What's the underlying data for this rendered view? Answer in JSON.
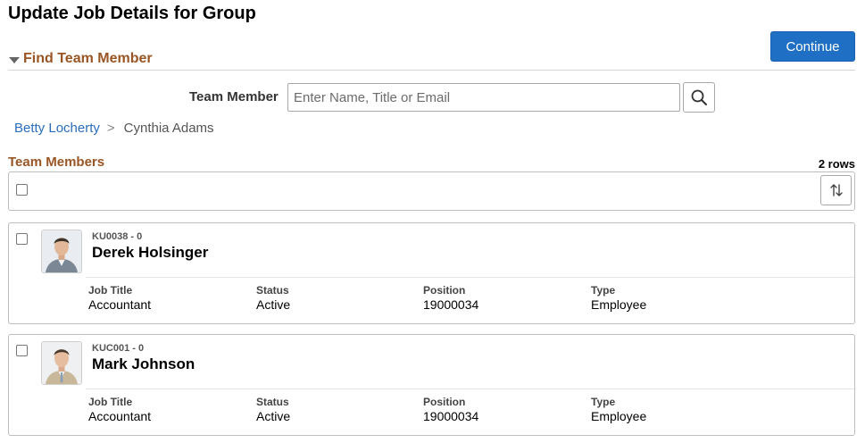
{
  "page": {
    "title": "Update Job Details for Group"
  },
  "actions": {
    "continue_label": "Continue"
  },
  "find_section": {
    "title": "Find Team Member",
    "team_member_label": "Team Member",
    "search_placeholder": "Enter Name, Title or Email",
    "search_value": ""
  },
  "breadcrumb": {
    "parent": "Betty Locherty",
    "separator": ">",
    "current": "Cynthia Adams"
  },
  "team_members": {
    "title": "Team Members",
    "row_count": "2 rows",
    "field_labels": {
      "job_title": "Job Title",
      "status": "Status",
      "position": "Position",
      "type": "Type"
    },
    "rows": [
      {
        "id": "KU0038 - 0",
        "name": "Derek Holsinger",
        "job_title": "Accountant",
        "status": "Active",
        "position": "19000034",
        "type": "Employee"
      },
      {
        "id": "KUC001 - 0",
        "name": "Mark Johnson",
        "job_title": "Accountant",
        "status": "Active",
        "position": "19000034",
        "type": "Employee"
      }
    ]
  },
  "colors": {
    "accent": "#1f6fc5",
    "section_title": "#9a5524",
    "link": "#2a6ebb"
  },
  "icons": {
    "section_toggle": "triangle-down-icon",
    "search": "search-icon",
    "sort": "sort-icon"
  }
}
